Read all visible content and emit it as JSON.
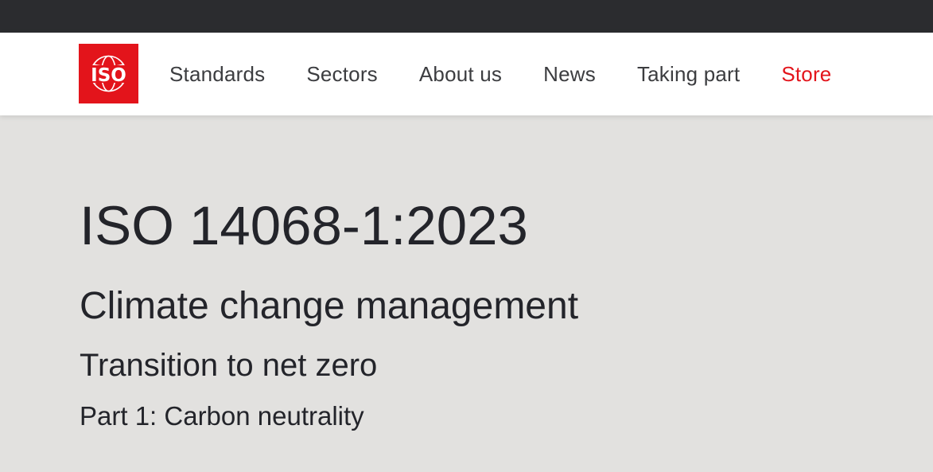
{
  "logo": {
    "text": "ISO",
    "icon": "iso-globe-logo",
    "color": "#e3141b"
  },
  "nav": {
    "items": [
      {
        "label": "Standards"
      },
      {
        "label": "Sectors"
      },
      {
        "label": "About us"
      },
      {
        "label": "News"
      },
      {
        "label": "Taking part"
      },
      {
        "label": "Store",
        "color": "#e3141b"
      }
    ]
  },
  "standard": {
    "code": "ISO 14068-1:2023",
    "title": "Climate change management",
    "subtitle": "Transition to net zero",
    "part": "Part 1: Carbon neutrality"
  },
  "colors": {
    "top_bar": "#2b2c2f",
    "nav_bg": "#ffffff",
    "page_bg": "#e2e1df",
    "text": "#23242a",
    "accent": "#e3141b"
  }
}
